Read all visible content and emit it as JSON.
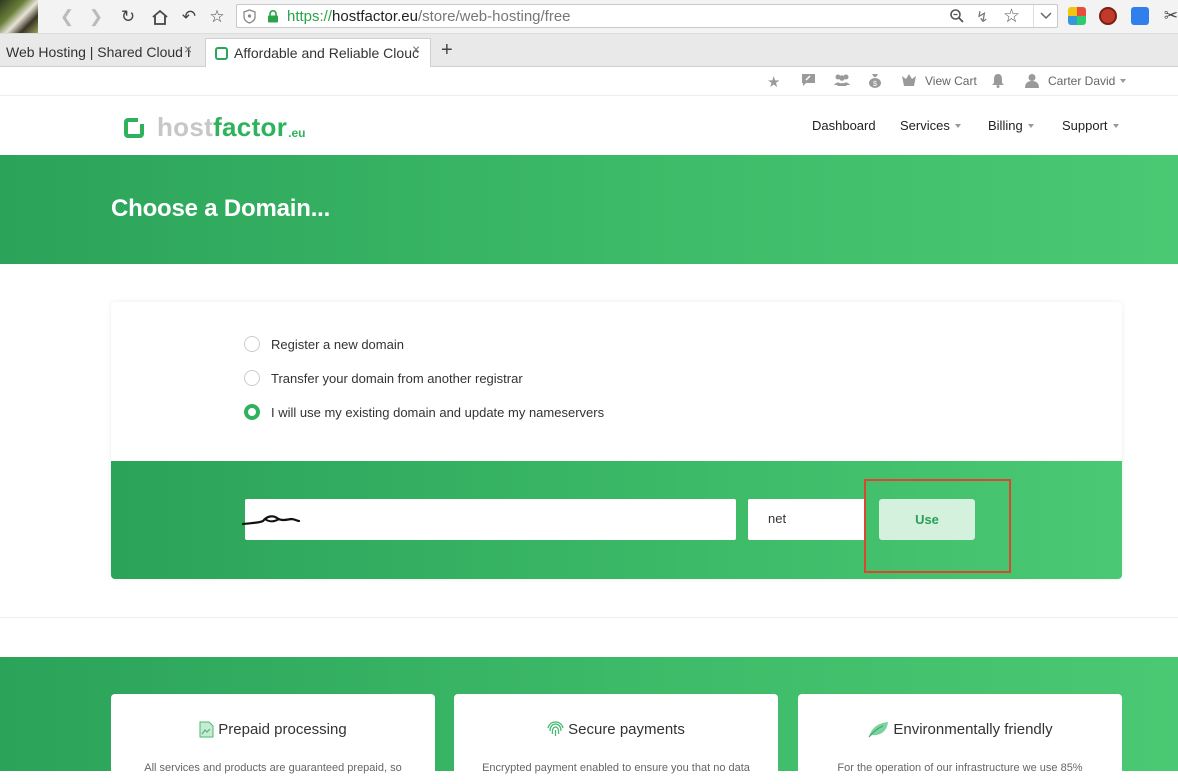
{
  "browser": {
    "url_protocol": "https://",
    "url_host": "hostfactor.eu",
    "url_path": "/store/web-hosting/free",
    "tabs": [
      {
        "title": "Web Hosting | Shared Cloud I",
        "close": "×"
      },
      {
        "title": "Affordable and Reliable Clouc",
        "close": "×"
      }
    ],
    "new_tab": "+"
  },
  "topbar": {
    "view_cart": "View Cart",
    "user_name": "Carter David"
  },
  "header": {
    "logo_host": "host",
    "logo_factor": "factor",
    "logo_tld": ".eu",
    "nav": {
      "dashboard": "Dashboard",
      "services": "Services",
      "billing": "Billing",
      "support": "Support"
    }
  },
  "banner": {
    "title": "Choose a Domain..."
  },
  "domain_options": [
    {
      "label": "Register a new domain",
      "selected": false
    },
    {
      "label": "Transfer your domain from another registrar",
      "selected": false
    },
    {
      "label": "I will use my existing domain and update my nameservers",
      "selected": true
    }
  ],
  "domain_form": {
    "tld": "net",
    "use_button": "Use"
  },
  "features": [
    {
      "title": "Prepaid processing",
      "desc": "All services and products are guaranteed prepaid, so"
    },
    {
      "title": "Secure payments",
      "desc": "Encrypted payment enabled to ensure you that no data"
    },
    {
      "title": "Environmentally friendly",
      "desc": "For the operation of our infrastructure we use 85%"
    }
  ],
  "colors": {
    "brand_green": "#2eb25c",
    "highlight_red": "#d9472f"
  }
}
